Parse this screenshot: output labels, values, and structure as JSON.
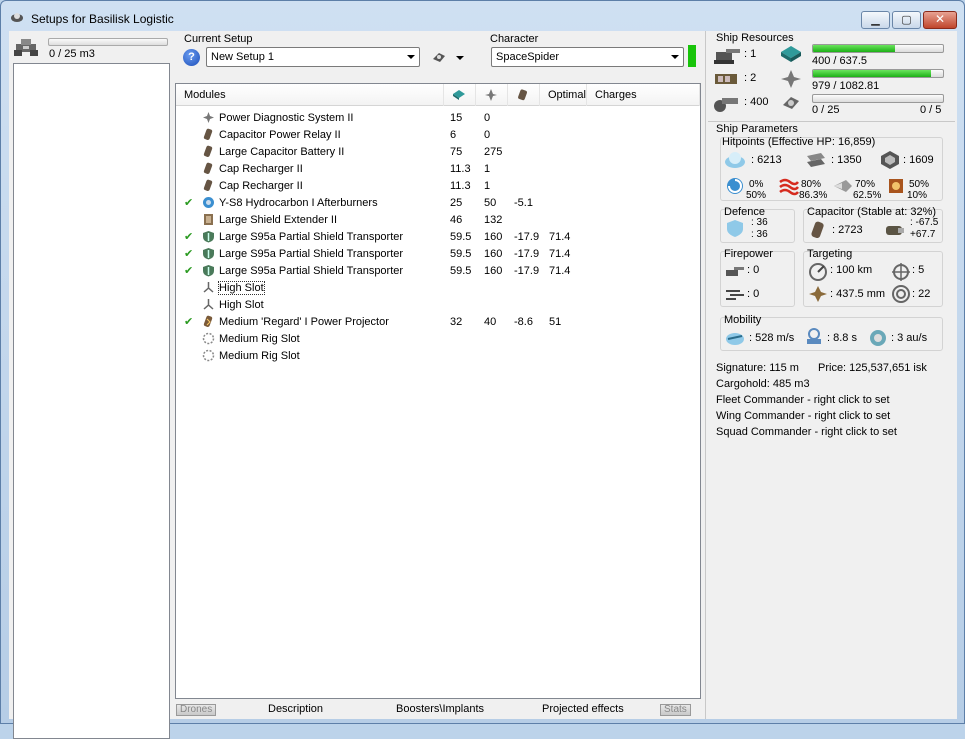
{
  "window": {
    "title": "Setups for Basilisk Logistic",
    "minimize_icon": "minimize-icon",
    "maximize_icon": "maximize-icon",
    "close_icon": "close-icon"
  },
  "cargo": {
    "text": "0 / 25 m3",
    "fill_fraction": 0.0
  },
  "setup": {
    "label": "Current Setup",
    "value": "New Setup 1"
  },
  "character": {
    "label": "Character",
    "value": "SpaceSpider",
    "status_color": "#18c40a"
  },
  "modules": {
    "headers": {
      "modules": "Modules",
      "optimal": "Optimal",
      "charges": "Charges"
    },
    "header_icons": [
      "cpu-icon",
      "powergrid-icon",
      "capacitor-icon"
    ],
    "rows": [
      {
        "checked": false,
        "icon": "powergrid-icon",
        "name": "Power Diagnostic System II",
        "cpu": "15",
        "pg": "0",
        "cap": "",
        "optimal": "",
        "charges": ""
      },
      {
        "checked": false,
        "icon": "capacitor-icon",
        "name": "Capacitor Power Relay II",
        "cpu": "6",
        "pg": "0",
        "cap": "",
        "optimal": "",
        "charges": ""
      },
      {
        "checked": false,
        "icon": "capacitor-icon",
        "name": "Large Capacitor Battery II",
        "cpu": "75",
        "pg": "275",
        "cap": "",
        "optimal": "",
        "charges": ""
      },
      {
        "checked": false,
        "icon": "capacitor-icon",
        "name": "Cap Recharger II",
        "cpu": "11.3",
        "pg": "1",
        "cap": "",
        "optimal": "",
        "charges": ""
      },
      {
        "checked": false,
        "icon": "capacitor-icon",
        "name": "Cap Recharger II",
        "cpu": "11.3",
        "pg": "1",
        "cap": "",
        "optimal": "",
        "charges": ""
      },
      {
        "checked": true,
        "icon": "afterburner-icon",
        "name": "Y-S8 Hydrocarbon I Afterburners",
        "cpu": "25",
        "pg": "50",
        "cap": "-5.1",
        "optimal": "",
        "charges": ""
      },
      {
        "checked": false,
        "icon": "shield-extender-icon",
        "name": "Large Shield Extender II",
        "cpu": "46",
        "pg": "132",
        "cap": "",
        "optimal": "",
        "charges": ""
      },
      {
        "checked": true,
        "icon": "shield-transporter-icon",
        "name": "Large S95a Partial Shield Transporter",
        "cpu": "59.5",
        "pg": "160",
        "cap": "-17.9",
        "optimal": "71.4",
        "charges": ""
      },
      {
        "checked": true,
        "icon": "shield-transporter-icon",
        "name": "Large S95a Partial Shield Transporter",
        "cpu": "59.5",
        "pg": "160",
        "cap": "-17.9",
        "optimal": "71.4",
        "charges": ""
      },
      {
        "checked": true,
        "icon": "shield-transporter-icon",
        "name": "Large S95a Partial Shield Transporter",
        "cpu": "59.5",
        "pg": "160",
        "cap": "-17.9",
        "optimal": "71.4",
        "charges": ""
      },
      {
        "checked": false,
        "icon": "high-slot-icon",
        "name": "High Slot",
        "cpu": "",
        "pg": "",
        "cap": "",
        "optimal": "",
        "charges": "",
        "focus": true
      },
      {
        "checked": false,
        "icon": "high-slot-icon",
        "name": "High Slot",
        "cpu": "",
        "pg": "",
        "cap": "",
        "optimal": "",
        "charges": ""
      },
      {
        "checked": true,
        "icon": "energy-transfer-icon",
        "name": "Medium 'Regard' I Power Projector",
        "cpu": "32",
        "pg": "40",
        "cap": "-8.6",
        "optimal": "51",
        "charges": ""
      },
      {
        "checked": false,
        "icon": "rig-slot-icon",
        "name": "Medium Rig Slot",
        "cpu": "",
        "pg": "",
        "cap": "",
        "optimal": "",
        "charges": ""
      },
      {
        "checked": false,
        "icon": "rig-slot-icon",
        "name": "Medium Rig Slot",
        "cpu": "",
        "pg": "",
        "cap": "",
        "optimal": "",
        "charges": ""
      }
    ]
  },
  "tabs": [
    "Drones",
    "Description",
    "Boosters\\Implants",
    "Projected effects",
    "Stats"
  ],
  "resources": {
    "label": "Ship Resources",
    "turret_slots": ": 1",
    "launcher_slots": ": 2",
    "calibration": ": 400",
    "cpu": {
      "text": "400 / 637.5",
      "fraction": 0.627
    },
    "powergrid": {
      "text": "979 / 1082.81",
      "fraction": 0.904
    },
    "drone_bay": {
      "text": "0 / 25",
      "fraction": 0.0
    },
    "drone_bandwidth": {
      "text": "0 / 5"
    }
  },
  "params": {
    "label": "Ship Parameters",
    "hitpoints": {
      "label": "Hitpoints (Effective HP: 16,859)",
      "shield": ": 6213",
      "armor": ": 1350",
      "structure": ": 1609",
      "res_em": [
        "0%",
        "50%"
      ],
      "res_thermal": [
        "80%",
        "86.3%"
      ],
      "res_kinetic": [
        "70%",
        "62.5%"
      ],
      "res_explosive": [
        "50%",
        "10%"
      ]
    },
    "defence": {
      "label": "Defence",
      "v1": ": 36",
      "v2": ": 36"
    },
    "capacitor": {
      "label": "Capacitor (Stable at: 32%)",
      "capacity": ": 2723",
      "v1": ": -67.5",
      "v2": "+67.7"
    },
    "firepower": {
      "label": "Firepower",
      "turret": ": 0",
      "missile": ": 0"
    },
    "targeting": {
      "label": "Targeting",
      "range": ": 100 km",
      "targets": ": 5",
      "resolution": ": 437.5 mm",
      "sensor": ": 22"
    },
    "mobility": {
      "label": "Mobility",
      "speed": ": 528 m/s",
      "align": ": 8.8 s",
      "warp": ": 3 au/s"
    }
  },
  "info": {
    "signature": "Signature: 115 m",
    "price": "Price: 125,537,651 isk",
    "cargohold": "Cargohold: 485 m3",
    "fleet": "Fleet Commander - right click to set",
    "wing": "Wing Commander - right click to set",
    "squad": "Squad Commander - right click to set"
  }
}
